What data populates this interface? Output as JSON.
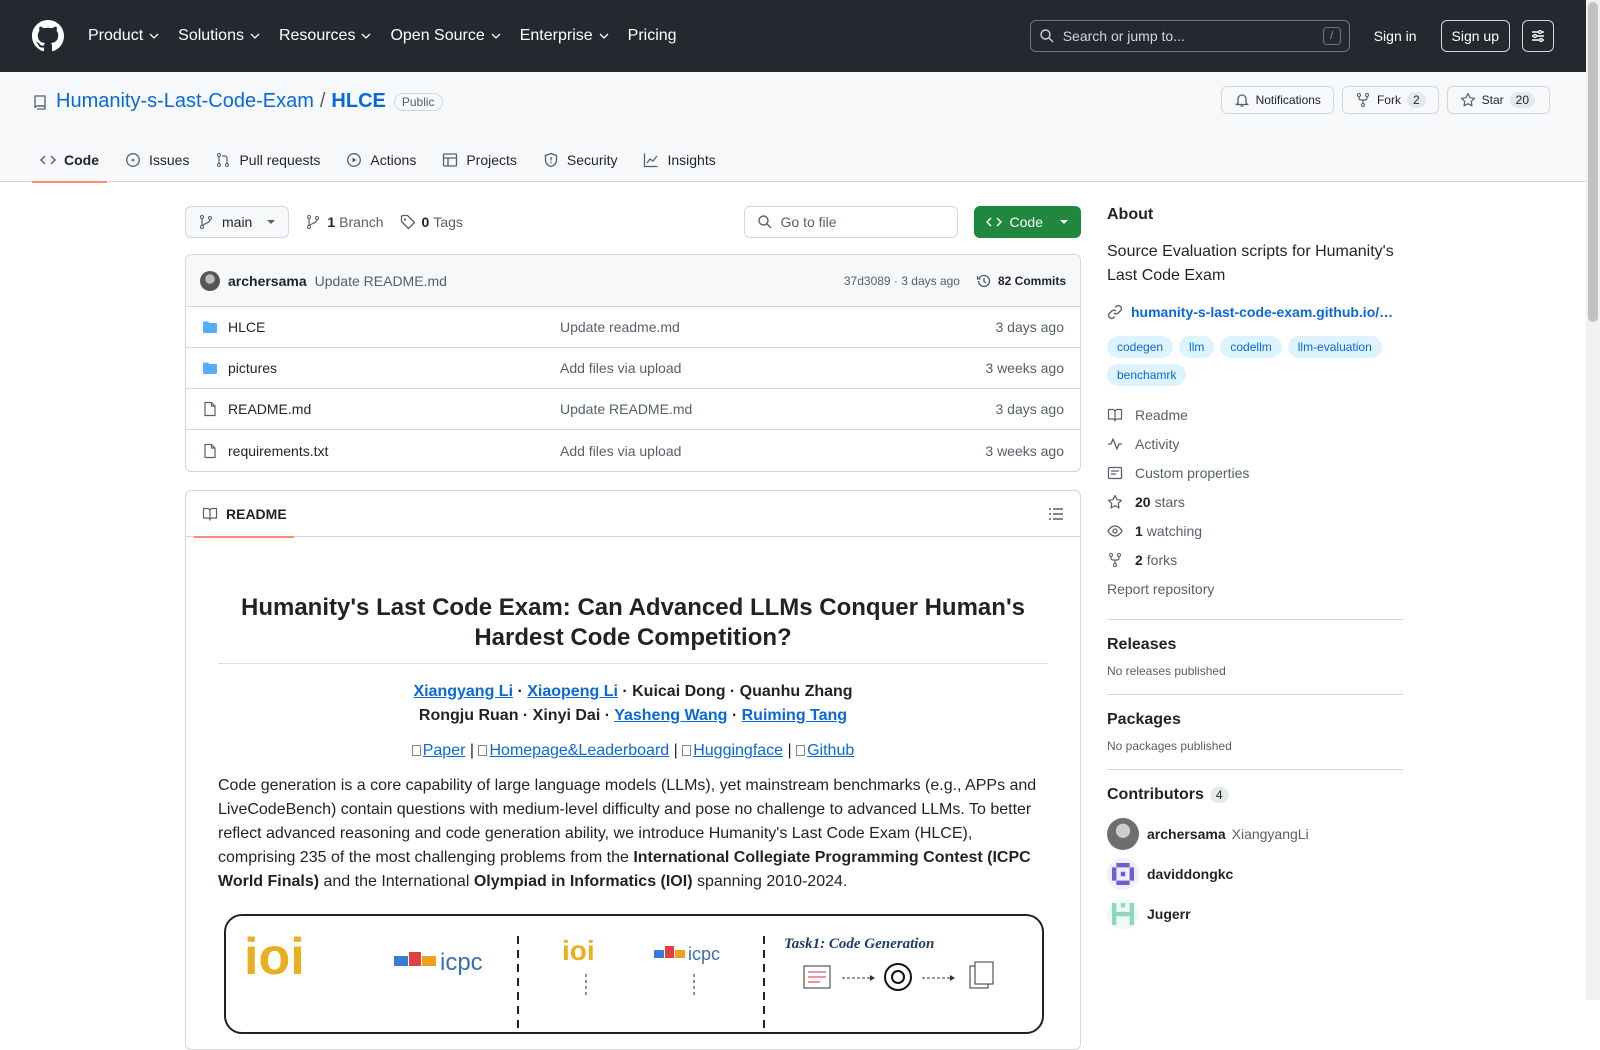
{
  "header": {
    "nav": [
      "Product",
      "Solutions",
      "Resources",
      "Open Source",
      "Enterprise",
      "Pricing"
    ],
    "search_placeholder": "Search or jump to...",
    "search_shortcut": "/",
    "signin": "Sign in",
    "signup": "Sign up"
  },
  "repo": {
    "owner": "Humanity-s-Last-Code-Exam",
    "separator": "/",
    "name": "HLCE",
    "visibility": "Public",
    "notifications": "Notifications",
    "fork_label": "Fork",
    "fork_count": "2",
    "star_label": "Star",
    "star_count": "20",
    "tabs": [
      "Code",
      "Issues",
      "Pull requests",
      "Actions",
      "Projects",
      "Security",
      "Insights"
    ]
  },
  "toolbar": {
    "branch": "main",
    "branch_count": "1",
    "branch_label": "Branch",
    "tag_count": "0",
    "tag_label": "Tags",
    "goto_placeholder": "Go to file",
    "code_button": "Code"
  },
  "commit": {
    "author": "archersama",
    "message": "Update README.md",
    "meta": "37d3089 · 3 days ago",
    "commits": "82 Commits"
  },
  "files": [
    {
      "name": "HLCE",
      "type": "folder",
      "message": "Update readme.md",
      "date": "3 days ago"
    },
    {
      "name": "pictures",
      "type": "folder",
      "message": "Add files via upload",
      "date": "3 weeks ago"
    },
    {
      "name": "README.md",
      "type": "file",
      "message": "Update README.md",
      "date": "3 days ago"
    },
    {
      "name": "requirements.txt",
      "type": "file",
      "message": "Add files via upload",
      "date": "3 weeks ago"
    }
  ],
  "readme": {
    "tab": "README",
    "title": "Humanity's Last Code Exam: Can Advanced LLMs Conquer Human's Hardest Code Competition?",
    "authors_line1": {
      "a1": "Xiangyang Li",
      "a2": "Xiaopeng Li",
      "rest": " · Kuicai Dong · Quanhu Zhang"
    },
    "authors_line2": {
      "pre": "Rongju Ruan · Xinyi Dai · ",
      "a3": "Yasheng Wang",
      "a4": "Ruiming Tang"
    },
    "dot": " · ",
    "links": [
      "Paper",
      "Homepage&Leaderboard",
      "Huggingface",
      "Github"
    ],
    "link_sep": " | ",
    "abstract_p1": "Code generation is a core capability of large language models (LLMs), yet mainstream benchmarks (e.g., APPs and LiveCodeBench) contain questions with medium-level difficulty and pose no challenge to advanced LLMs. To better reflect advanced reasoning and code generation ability, we introduce Humanity's Last Code Exam (HLCE), comprising 235 of the most challenging problems from the ",
    "abstract_b1": "International Collegiate Programming Contest (ICPC World Finals)",
    "abstract_p2": " and the International ",
    "abstract_b2": "Olympiad in Informatics (IOI)",
    "abstract_p3": " spanning 2010-2024.",
    "figure_task": "Task1: Code Generation",
    "figure_ioi": "ioi",
    "figure_icpc": "icpc"
  },
  "sidebar": {
    "about_title": "About",
    "description": "Source Evaluation scripts for Humanity's Last Code Exam",
    "homepage": "humanity-s-last-code-exam.github.io/…",
    "topics": [
      "codegen",
      "llm",
      "codellm",
      "llm-evaluation",
      "benchamrk"
    ],
    "items": [
      {
        "icon": "book-icon",
        "count": "",
        "label": "Readme"
      },
      {
        "icon": "pulse-icon",
        "count": "",
        "label": "Activity"
      },
      {
        "icon": "note-icon",
        "count": "",
        "label": "Custom properties"
      },
      {
        "icon": "star-icon",
        "count": "20",
        "label": "stars"
      },
      {
        "icon": "eye-icon",
        "count": "1",
        "label": "watching"
      },
      {
        "icon": "fork-icon",
        "count": "2",
        "label": "forks"
      }
    ],
    "report": "Report repository",
    "releases_title": "Releases",
    "releases_text": "No releases published",
    "packages_title": "Packages",
    "packages_text": "No packages published",
    "contributors_title": "Contributors",
    "contributors_count": "4",
    "contributors": [
      {
        "login": "archersama",
        "name": "XiangyangLi",
        "color": "#6e6e6e"
      },
      {
        "login": "daviddongkc",
        "name": "",
        "color": "#6f5fc9"
      },
      {
        "login": "Jugerr",
        "name": "",
        "color": "#8fd6c2"
      }
    ]
  }
}
